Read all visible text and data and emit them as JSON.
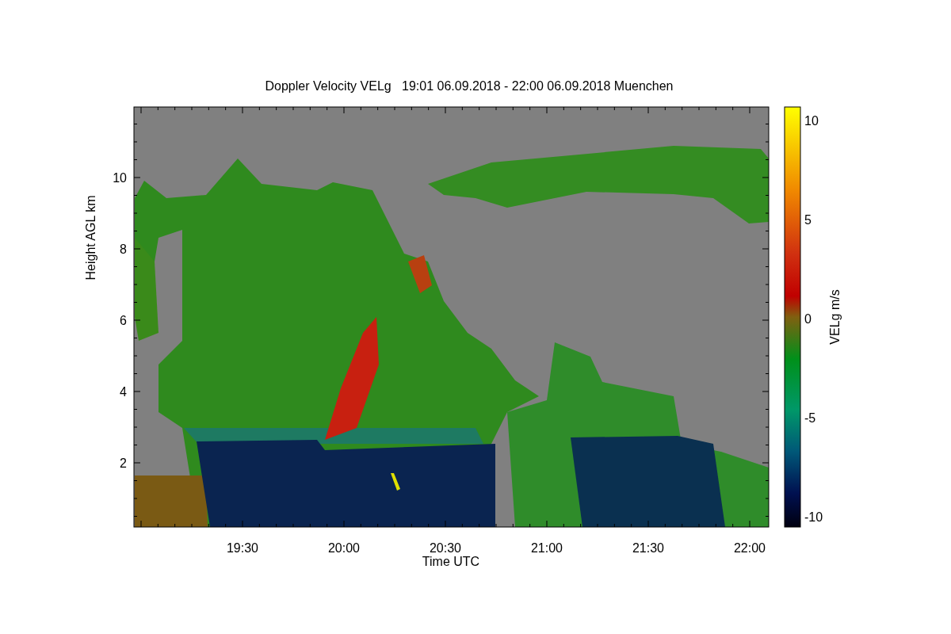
{
  "title": "Doppler Velocity VELg   19:01 06.09.2018 - 22:00 06.09.2018 Muenchen",
  "x_axis": {
    "label": "Time UTC",
    "ticks": [
      "19:30",
      "20:00",
      "20:30",
      "21:00",
      "21:30",
      "22:00"
    ]
  },
  "y_axis": {
    "label": "Height AGL km",
    "ticks": [
      "10",
      "8",
      "6",
      "4",
      "2"
    ]
  },
  "colorbar": {
    "label": "VELg m/s",
    "ticks": [
      "10",
      "5",
      "0",
      "-5",
      "-10"
    ]
  }
}
